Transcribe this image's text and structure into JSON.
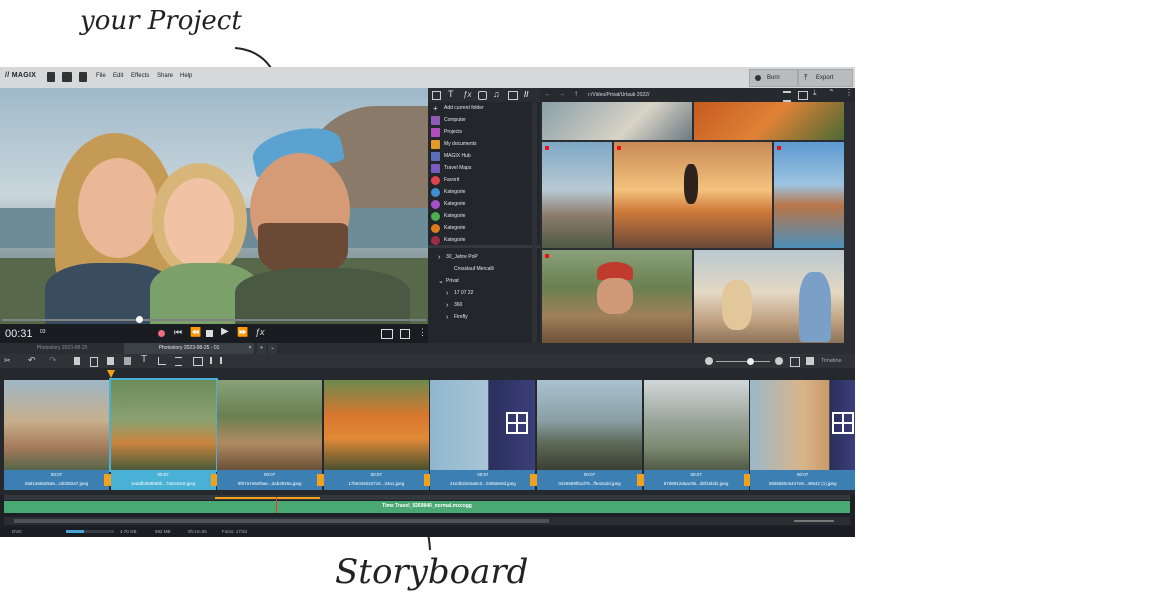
{
  "annotations": {
    "top": "your Project",
    "bottom": "Storyboard"
  },
  "menubar": {
    "brand": "// MAGIX",
    "menu": [
      "File",
      "Edit",
      "Effects",
      "Share",
      "Help"
    ],
    "burn_label": "Burn",
    "export_label": "Export"
  },
  "transport": {
    "time": "00:31",
    "time_frames": "03"
  },
  "sidepanel": {
    "add_folder": "Add current folder",
    "items": [
      {
        "label": "Computer",
        "color": "#8f5bb5"
      },
      {
        "label": "Projects",
        "color": "#b14fbf"
      },
      {
        "label": "My documents",
        "color": "#e39b27"
      },
      {
        "label": "MAGIX Hub",
        "color": "#5a6fb8"
      },
      {
        "label": "Travel Maps",
        "color": "#7a5bc0"
      },
      {
        "label": "Favorit",
        "color": "#e0434d"
      },
      {
        "label": "Kategorie",
        "color": "#3d8fd1"
      },
      {
        "label": "Kategorie",
        "color": "#a24fc9"
      },
      {
        "label": "Kategorie",
        "color": "#4caf50"
      },
      {
        "label": "Kategorie",
        "color": "#e07a1e"
      },
      {
        "label": "Kategorie",
        "color": "#9c2f45"
      }
    ],
    "tree": [
      "30_Jahre PoP",
      "Crosslauf Mercalli",
      "Privat",
      "17 07 22",
      "360",
      "Firefly"
    ]
  },
  "media": {
    "path": "r:/Video/Privat/Urlaub 2022/"
  },
  "tabs": [
    {
      "label": "Photostory 2023-08-25"
    },
    {
      "label": "Photostory 2023-08-25 - 01"
    }
  ],
  "timeline_label": "Timeline",
  "storyboard": [
    {
      "dur": "00:07",
      "name": "0a81a55625a5...cd0382a7.jpeg",
      "color": "#3b7fb3"
    },
    {
      "dur": "00:07",
      "name": "1ea5fb358b89b...7a0246c8.jpeg",
      "color": "#49b0d6"
    },
    {
      "dur": "00:07",
      "name": "9f67a7e8ef6ae...dab3926a.jpeg",
      "color": "#3b7fb3"
    },
    {
      "dur": "00:07",
      "name": "17b63460227c8...34a1.jpeg",
      "color": "#3b7fb3"
    },
    {
      "dur": "00:07",
      "name": "41e3b22e3a6c0...04559e0d.jpeg",
      "color": "#3b7fb3"
    },
    {
      "dur": "00:07",
      "name": "0425589f61d79...ffe42a20.jpeg",
      "color": "#3b7fb3"
    },
    {
      "dur": "00:07",
      "name": "87d6912daac9b...d5f16bd2.jpeg",
      "color": "#3b7fb3"
    },
    {
      "dur": "00:07",
      "name": "0655560c6447e8...48542 (1).jpeg",
      "color": "#3b7fb3"
    }
  ],
  "audio_track": "Time Travel_9269840_normal.mxcogg",
  "status": {
    "mode": "DVD",
    "size": "4.70 GB",
    "used": "592 MB",
    "duration": "0h:1m:26",
    "fotos": "Fotos: 17/33"
  }
}
